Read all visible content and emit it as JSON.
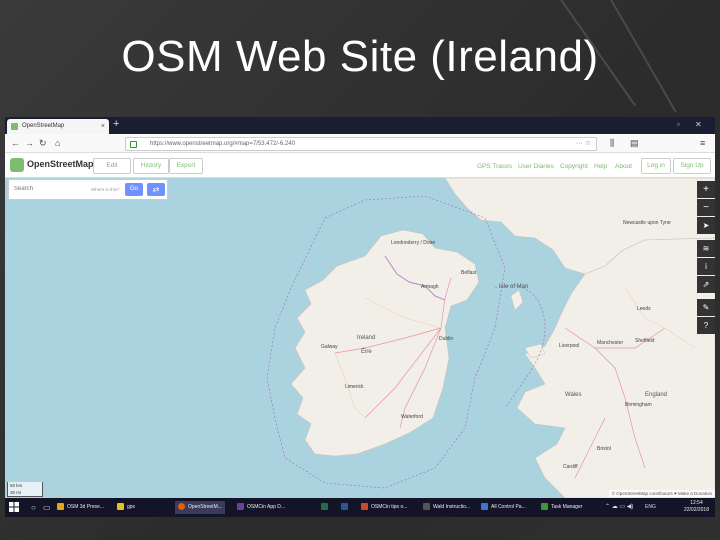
{
  "slide": {
    "title": "OSM Web Site (Ireland)"
  },
  "browser": {
    "tab_title": "OpenStreetMap",
    "tab_close": "×",
    "new_tab": "+",
    "url": "https://www.openstreetmap.org/#map=7/53.472/-6.240",
    "tab_controls": [
      "▫",
      "✕"
    ]
  },
  "osm": {
    "logo_text": "OpenStreetMap",
    "edit_label": "Edit",
    "history_label": "History",
    "export_label": "Export",
    "nav_links": [
      "GPS Traces",
      "User Diaries",
      "Copyright",
      "Help",
      "About"
    ],
    "login_label": "Log in",
    "signup_label": "Sign Up",
    "search_placeholder": "Search",
    "where_label": "Where is this?",
    "go_label": "Go"
  },
  "map": {
    "labels": {
      "londonderry": "Londonderry / Doire",
      "belfast": "Belfast",
      "armagh": "Armagh",
      "ireland": "Ireland",
      "eire": "Éire",
      "dublin": "Dublin",
      "galway": "Galway",
      "limerick": "Limerick",
      "waterford": "Waterford",
      "isle_of_man": "Isle of Man",
      "liverpool": "Liverpool",
      "manchester": "Manchester",
      "sheffield": "Sheffield",
      "birmingham": "Birmingham",
      "cardiff": "Cardiff",
      "bristol": "Bristol",
      "newcastle": "Newcastle upon Tyne",
      "leeds": "Leeds",
      "wales": "Wales",
      "england": "England"
    },
    "scale_km": "50 km",
    "scale_mi": "30 mi",
    "attribution": "© OpenStreetMap contributors ♥ Make a Donation"
  },
  "taskbar": {
    "items": [
      {
        "label": "OSM 3d Prese...",
        "color": "#e8a317"
      },
      {
        "label": "gpx",
        "color": "#e8c317"
      },
      {
        "label": "OpenStreetM...",
        "color": "#e66000"
      },
      {
        "label": "OSMCin App D...",
        "color": "#6b3fa0"
      },
      {
        "label": "",
        "color": "#1e7145"
      },
      {
        "label": "",
        "color": "#2b579a"
      },
      {
        "label": "OSMCin tips o...",
        "color": "#d24726"
      },
      {
        "label": "Wald Instructio...",
        "color": "#555555"
      },
      {
        "label": "All Control Pa...",
        "color": "#3a78c9"
      },
      {
        "label": "Task Manager",
        "color": "#3a9a3a"
      }
    ],
    "time": "12:54",
    "date": "22/02/2018",
    "lang": "ENG"
  }
}
